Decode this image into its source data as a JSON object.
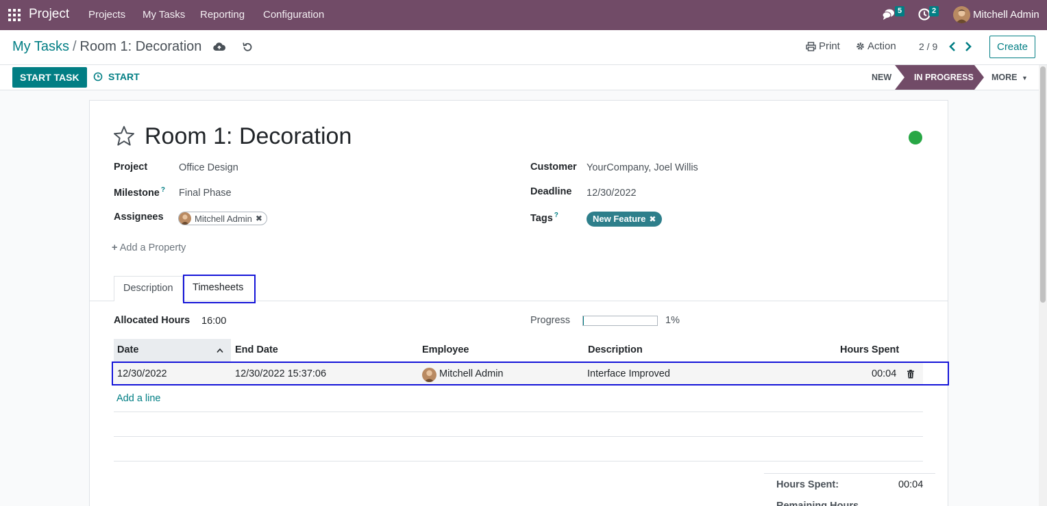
{
  "navbar": {
    "app_title": "Project",
    "menu": [
      "Projects",
      "My Tasks",
      "Reporting",
      "Configuration"
    ],
    "messages_count": "5",
    "activities_count": "2",
    "user_name": "Mitchell Admin"
  },
  "control_panel": {
    "breadcrumb_parent": "My Tasks",
    "breadcrumb_separator": "/",
    "breadcrumb_current": "Room 1: Decoration",
    "print_label": "Print",
    "action_label": "Action",
    "pager": "2 / 9",
    "create_label": "Create"
  },
  "statusbar": {
    "start_task_label": "START TASK",
    "start_label": "START",
    "stages": {
      "new": "NEW",
      "in_progress": "IN PROGRESS",
      "more": "MORE"
    }
  },
  "task": {
    "title": "Room 1: Decoration",
    "kanban_state_color": "#28a745",
    "fields": {
      "project_label": "Project",
      "project_value": "Office Design",
      "milestone_label": "Milestone",
      "help_mark": "?",
      "milestone_value": "Final Phase",
      "assignees_label": "Assignees",
      "assignee": "Mitchell Admin",
      "customer_label": "Customer",
      "customer_value": "YourCompany, Joel Willis",
      "deadline_label": "Deadline",
      "deadline_value": "12/30/2022",
      "tags_label": "Tags",
      "tag": "New Feature"
    },
    "add_property": "Add a Property"
  },
  "tabs": [
    {
      "label": "Description"
    },
    {
      "label": "Timesheets"
    }
  ],
  "timesheets": {
    "allocated_label": "Allocated Hours",
    "allocated_value": "16:00",
    "progress_label": "Progress",
    "progress_value": "1%",
    "progress_fraction": 0.01,
    "columns": [
      "Date",
      "End Date",
      "Employee",
      "Description",
      "Hours Spent"
    ],
    "rows": [
      {
        "date": "12/30/2022",
        "end_date": "12/30/2022 15:37:06",
        "employee": "Mitchell Admin",
        "description": "Interface Improved",
        "hours": "00:04"
      }
    ],
    "add_line": "Add a line",
    "summary_hours_label": "Hours Spent:",
    "summary_hours_value": "00:04",
    "summary_remaining_label": "Remaining Hours"
  },
  "colors": {
    "brand": "#714b67",
    "accent": "#017e84",
    "highlight": "#1414d8"
  }
}
